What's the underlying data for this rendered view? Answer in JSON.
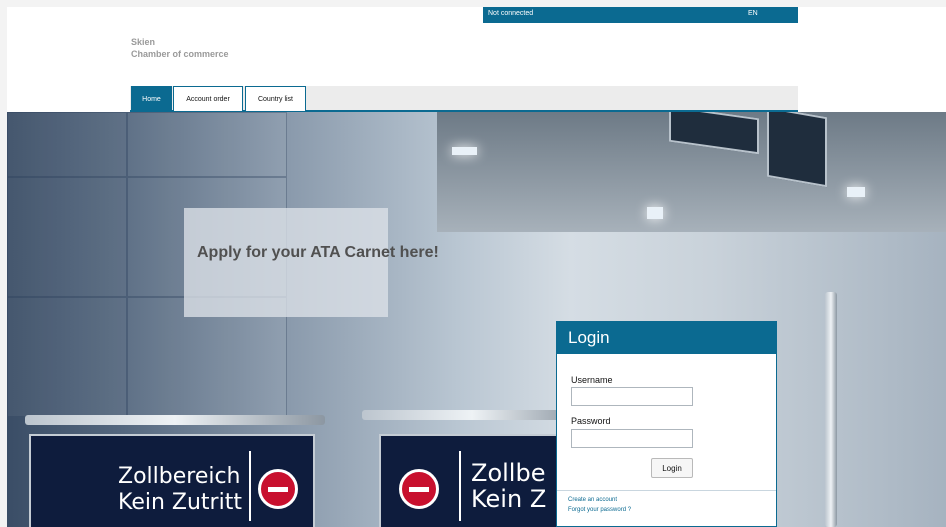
{
  "status_bar": {
    "connection": "Not connected",
    "language": "EN"
  },
  "brand": {
    "line1": "Skien",
    "line2": "Chamber of commerce"
  },
  "nav": {
    "tabs": [
      {
        "label": "Home",
        "active": true
      },
      {
        "label": "Account order",
        "active": false
      },
      {
        "label": "Country list",
        "active": false
      }
    ]
  },
  "hero": {
    "promo": "Apply for your ATA Carnet here!",
    "signs": [
      {
        "line1": "Zollbereich",
        "line2": "Kein Zutritt"
      },
      {
        "line1": "Zollbe",
        "line2": "Kein Z"
      }
    ]
  },
  "login": {
    "title": "Login",
    "username_label": "Username",
    "password_label": "Password",
    "button": "Login",
    "create_account": "Create an account",
    "forgot_password": "Forgot your password ?"
  },
  "colors": {
    "accent": "#0b6a91",
    "no_entry": "#c8102e"
  }
}
